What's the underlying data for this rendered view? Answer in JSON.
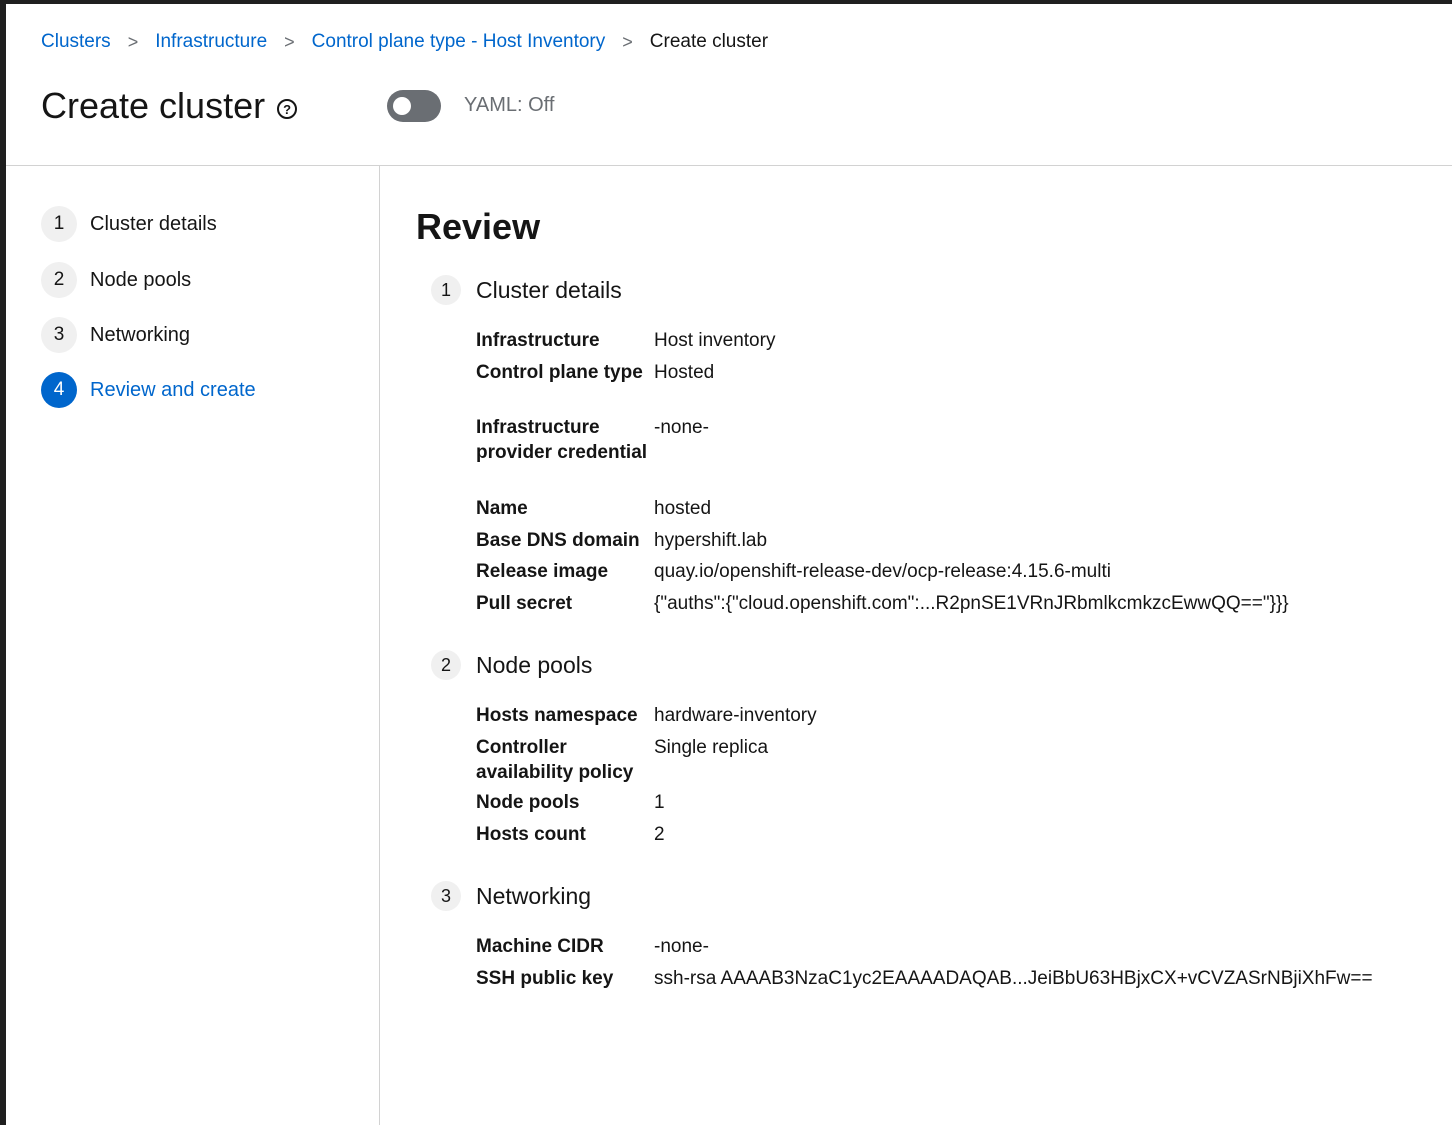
{
  "breadcrumb": {
    "items": [
      "Clusters",
      "Infrastructure",
      "Control plane type - Host Inventory"
    ],
    "current": "Create cluster",
    "separator": ">"
  },
  "header": {
    "title": "Create cluster",
    "help_icon": "help-circle-icon",
    "yaml_toggle": {
      "label": "YAML: Off",
      "on": false
    }
  },
  "wizard": {
    "steps": [
      {
        "num": "1",
        "label": "Cluster details",
        "active": false
      },
      {
        "num": "2",
        "label": "Node pools",
        "active": false
      },
      {
        "num": "3",
        "label": "Networking",
        "active": false
      },
      {
        "num": "4",
        "label": "Review and create",
        "active": true
      }
    ]
  },
  "review": {
    "title": "Review",
    "sections": [
      {
        "num": "1",
        "title": "Cluster details",
        "rows": [
          {
            "term": "Infrastructure",
            "value": "Host inventory"
          },
          {
            "term": "Control plane type",
            "value": "Hosted"
          },
          {
            "term": "Infrastructure provider credential",
            "value": "-none-"
          },
          {
            "term": "Name",
            "value": "hosted"
          },
          {
            "term": "Base DNS domain",
            "value": "hypershift.lab"
          },
          {
            "term": "Release image",
            "value": "quay.io/openshift-release-dev/ocp-release:4.15.6-multi"
          },
          {
            "term": "Pull secret",
            "value": "{\"auths\":{\"cloud.openshift.com\":...R2pnSE1VRnJRbmlkcmkzcEwwQQ==\"}}}"
          }
        ]
      },
      {
        "num": "2",
        "title": "Node pools",
        "rows": [
          {
            "term": "Hosts namespace",
            "value": "hardware-inventory"
          },
          {
            "term": "Controller availability policy",
            "value": "Single replica"
          },
          {
            "term": "Node pools",
            "value": "1"
          },
          {
            "term": "Hosts count",
            "value": "2"
          }
        ]
      },
      {
        "num": "3",
        "title": "Networking",
        "rows": [
          {
            "term": "Machine CIDR",
            "value": "-none-"
          },
          {
            "term": "SSH public key",
            "value": "ssh-rsa AAAAB3NzaC1yc2EAAAADAQAB...JeiBbU63HBjxCX+vCVZASrNBjiXhFw=="
          }
        ]
      }
    ]
  },
  "colors": {
    "link": "#0066cc",
    "active_step": "#0066cc",
    "toggle_off": "#6a6e73",
    "border": "#d2d2d2",
    "text": "#151515"
  }
}
